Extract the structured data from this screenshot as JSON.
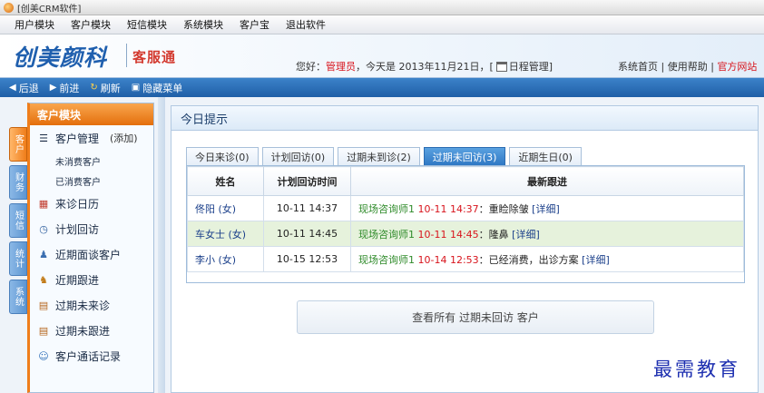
{
  "window": {
    "title": "[创美CRM软件]"
  },
  "menubar": [
    "用户模块",
    "客户模块",
    "短信模块",
    "系统模块",
    "客户宝",
    "退出软件"
  ],
  "header": {
    "logo_main": "创美颜科",
    "logo_sub": "客服通",
    "greeting_prefix": "您好：",
    "user": "管理员",
    "greeting_middle": "，今天是 2013年11月21日，[",
    "schedule_link": "日程管理",
    "greeting_suffix": "]",
    "links": {
      "home": "系统首页",
      "help": "使用帮助",
      "site": "官方网站",
      "sep": "|"
    }
  },
  "navbar": {
    "back": "后退",
    "forward": "前进",
    "refresh": "刷新",
    "hide_menu": "隐藏菜单"
  },
  "vtabs": [
    "客户",
    "财务",
    "短信",
    "统计",
    "系统"
  ],
  "sidebar": {
    "title": "客户模块",
    "customer_mgmt": "客户管理",
    "add_label": "(添加)",
    "sub_items": [
      "未消费客户",
      "已消费客户"
    ],
    "items": [
      "来诊日历",
      "计划回访",
      "近期面谈客户",
      "近期跟进",
      "过期未来诊",
      "过期未跟进",
      "客户通话记录"
    ]
  },
  "main": {
    "title": "今日提示",
    "tabs": [
      "今日来诊(0)",
      "计划回访(0)",
      "过期未到诊(2)",
      "过期未回访(3)",
      "近期生日(0)"
    ],
    "active_tab": 3,
    "table": {
      "headers": [
        "姓名",
        "计划回访时间",
        "最新跟进"
      ],
      "rows": [
        {
          "name": "佟阳 (女)",
          "time": "10-11 14:37",
          "staff": "现场咨询师1",
          "date": "10-11 14:37",
          "note": "：重睑除皱",
          "detail": "[详细]"
        },
        {
          "name": "车女士 (女)",
          "time": "10-11 14:45",
          "staff": "现场咨询师1",
          "date": "10-11 14:45",
          "note": "：隆鼻",
          "detail": "[详细]"
        },
        {
          "name": "李小 (女)",
          "time": "10-15 12:53",
          "staff": "现场咨询师1",
          "date": "10-14 12:53",
          "note": "：已经消费，出诊方案",
          "detail": "[详细]"
        }
      ]
    },
    "view_all": "查看所有 过期未回访 客户"
  },
  "watermark": "最需教育"
}
